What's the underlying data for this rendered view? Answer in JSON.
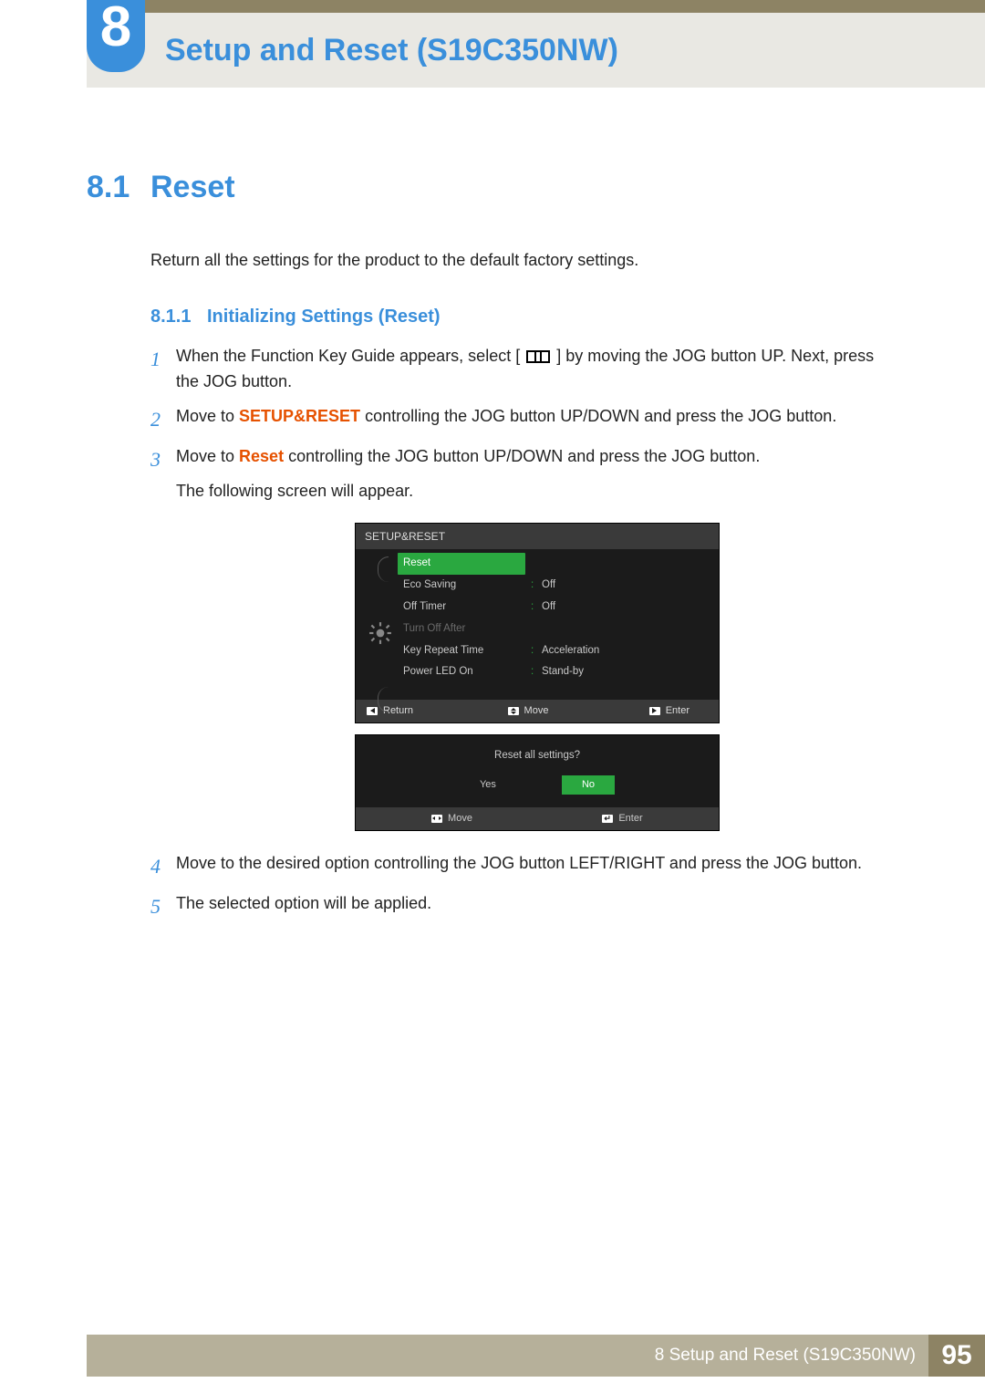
{
  "chapter": {
    "number": "8",
    "title": "Setup and Reset (S19C350NW)"
  },
  "section": {
    "number": "8.1",
    "title": "Reset",
    "intro": "Return all the settings for the product to the default factory settings."
  },
  "subsection": {
    "number": "8.1.1",
    "title": "Initializing Settings (Reset)"
  },
  "steps": {
    "s1a": "When the Function Key Guide appears, select ",
    "s1b": " by moving the JOG button UP. Next, press the JOG button.",
    "s2a": "Move to ",
    "s2kw": "SETUP&RESET",
    "s2b": " controlling the JOG button UP/DOWN and press the JOG button.",
    "s3a": "Move to ",
    "s3kw": "Reset",
    "s3b": " controlling the JOG button UP/DOWN and press the JOG button.",
    "s3c": "The following screen will appear.",
    "s4": "Move to the desired option controlling the JOG button LEFT/RIGHT and press the JOG button.",
    "s5": "The selected option will be applied."
  },
  "stepnums": {
    "n1": "1",
    "n2": "2",
    "n3": "3",
    "n4": "4",
    "n5": "5"
  },
  "osd": {
    "title": "SETUP&RESET",
    "items": {
      "reset": "Reset",
      "eco": "Eco Saving",
      "eco_v": "Off",
      "offtimer": "Off Timer",
      "offtimer_v": "Off",
      "turnoff": "Turn Off After",
      "keyrep": "Key Repeat Time",
      "keyrep_v": "Acceleration",
      "powerled": "Power LED On",
      "powerled_v": "Stand-by"
    },
    "footer": {
      "return": "Return",
      "move": "Move",
      "enter": "Enter"
    }
  },
  "dialog": {
    "question": "Reset all settings?",
    "yes": "Yes",
    "no": "No",
    "footer": {
      "move": "Move",
      "enter": "Enter"
    }
  },
  "footer": {
    "text": "8 Setup and Reset (S19C350NW)",
    "page": "95"
  },
  "brackets": {
    "open": "[",
    "close": "]"
  }
}
